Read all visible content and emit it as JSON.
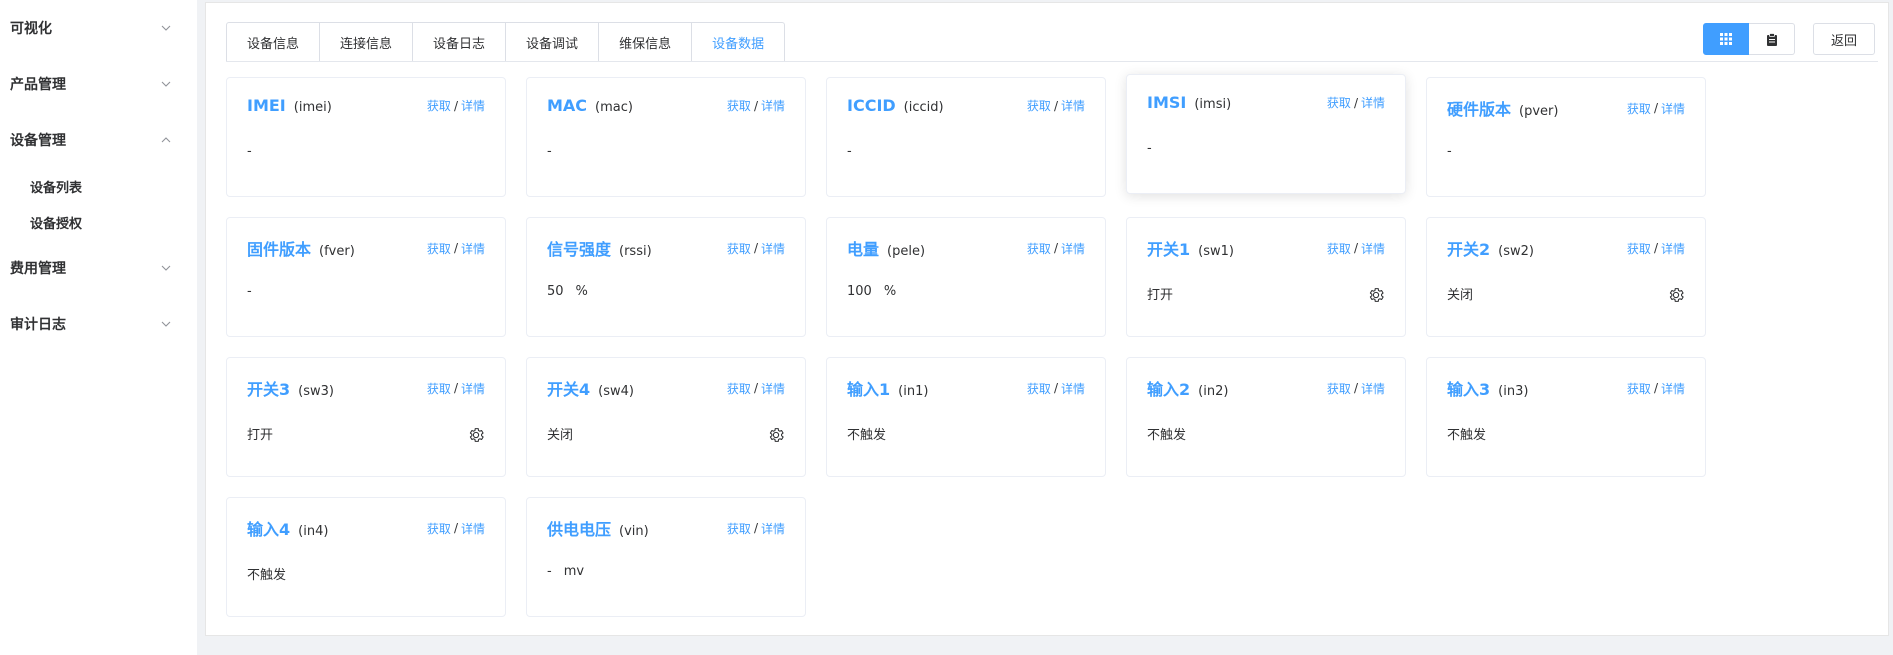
{
  "sidebar": {
    "menu": [
      {
        "label": "可视化"
      },
      {
        "label": "产品管理"
      },
      {
        "label": "设备管理"
      },
      {
        "label": "费用管理"
      },
      {
        "label": "审计日志"
      }
    ],
    "submenu": [
      {
        "label": "设备列表"
      },
      {
        "label": "设备授权"
      }
    ]
  },
  "tabs": [
    {
      "label": "设备信息"
    },
    {
      "label": "连接信息"
    },
    {
      "label": "设备日志"
    },
    {
      "label": "设备调试"
    },
    {
      "label": "维保信息"
    },
    {
      "label": "设备数据"
    }
  ],
  "active_tab": "设备数据",
  "toolbar": {
    "grid_icon": "grid-icon",
    "list_icon": "clipboard-icon",
    "back_label": "返回"
  },
  "actions": {
    "fetch": "获取",
    "sep": "/",
    "detail": "详情"
  },
  "colors": {
    "accent": "#409eff",
    "text": "#303133",
    "border": "#ebeef5"
  },
  "cards": [
    {
      "name": "IMEI",
      "id": "(imei)",
      "value": "-",
      "unit": ""
    },
    {
      "name": "MAC",
      "id": "(mac)",
      "value": "-",
      "unit": ""
    },
    {
      "name": "ICCID",
      "id": "(iccid)",
      "value": "-",
      "unit": ""
    },
    {
      "name": "IMSI",
      "id": "(imsi)",
      "value": "-",
      "unit": ""
    },
    {
      "name": "硬件版本",
      "id": "(pver)",
      "value": "-",
      "unit": ""
    },
    {
      "name": "固件版本",
      "id": "(fver)",
      "value": "-",
      "unit": ""
    },
    {
      "name": "信号强度",
      "id": "(rssi)",
      "value": "50",
      "unit": "%"
    },
    {
      "name": "电量",
      "id": "(pele)",
      "value": "100",
      "unit": "%"
    },
    {
      "name": "开关1",
      "id": "(sw1)",
      "value": "打开",
      "unit": ""
    },
    {
      "name": "开关2",
      "id": "(sw2)",
      "value": "关闭",
      "unit": ""
    },
    {
      "name": "开关3",
      "id": "(sw3)",
      "value": "打开",
      "unit": ""
    },
    {
      "name": "开关4",
      "id": "(sw4)",
      "value": "关闭",
      "unit": ""
    },
    {
      "name": "输入1",
      "id": "(in1)",
      "value": "不触发",
      "unit": ""
    },
    {
      "name": "输入2",
      "id": "(in2)",
      "value": "不触发",
      "unit": ""
    },
    {
      "name": "输入3",
      "id": "(in3)",
      "value": "不触发",
      "unit": ""
    },
    {
      "name": "输入4",
      "id": "(in4)",
      "value": "不触发",
      "unit": ""
    },
    {
      "name": "供电电压",
      "id": "(vin)",
      "value": "-",
      "unit": "mv"
    }
  ]
}
